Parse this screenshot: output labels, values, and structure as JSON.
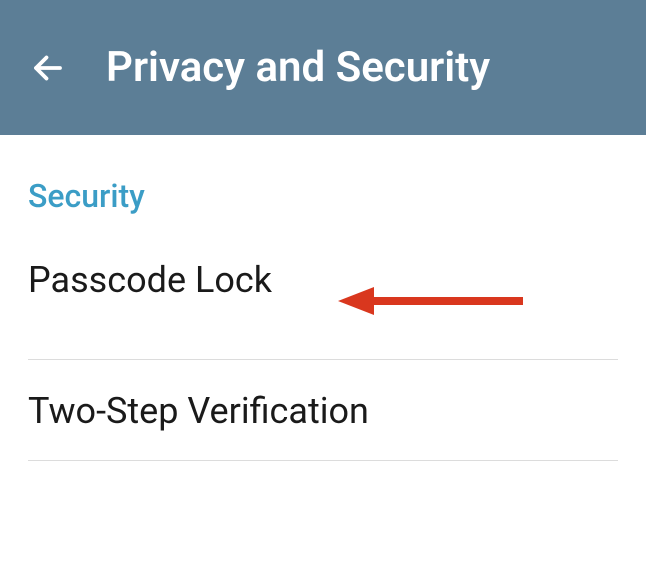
{
  "header": {
    "title": "Privacy and Security"
  },
  "section": {
    "title": "Security",
    "items": [
      {
        "label": "Passcode Lock"
      },
      {
        "label": "Two-Step Verification"
      }
    ]
  },
  "annotation": {
    "arrow_color": "#d9371e"
  }
}
